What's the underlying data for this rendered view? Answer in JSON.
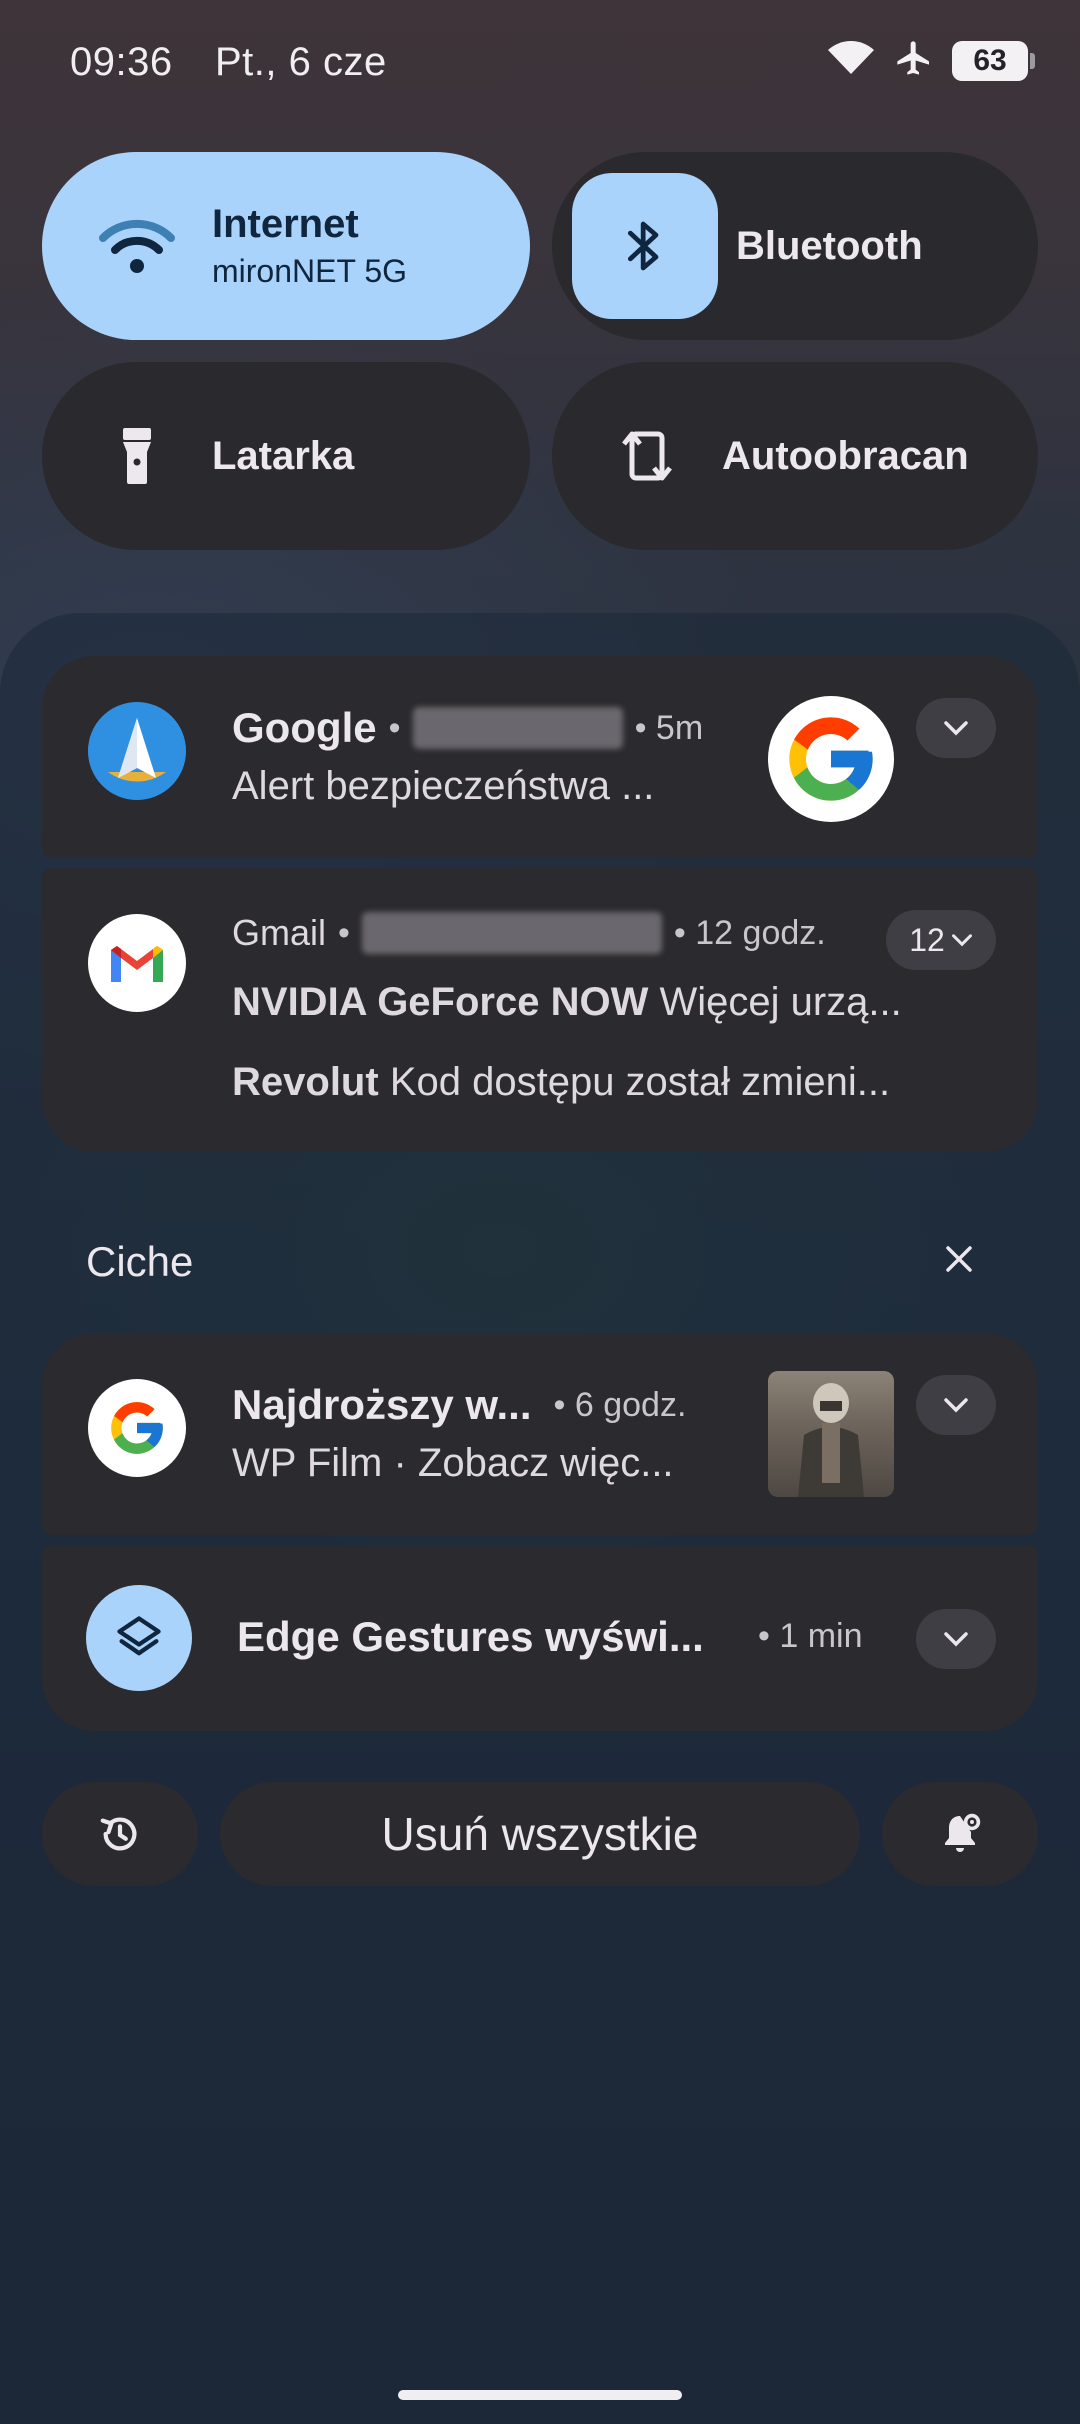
{
  "status_bar": {
    "time": "09:36",
    "date": "Pt., 6 cze",
    "battery": "63",
    "icons": [
      "wifi-icon",
      "airplane-icon",
      "battery-icon"
    ]
  },
  "quick_settings": {
    "internet": {
      "title": "Internet",
      "subtitle": "mironNET 5G",
      "active": true
    },
    "bluetooth": {
      "title": "Bluetooth",
      "active": true
    },
    "flashlight": {
      "title": "Latarka",
      "active": false
    },
    "autorotate": {
      "title": "Autoobracan",
      "active": false
    }
  },
  "notifications": {
    "google": {
      "app": "Google",
      "time": "• 5m",
      "text": "Alert bezpieczeństwa ...",
      "icon": "send-arrow-icon"
    },
    "gmail": {
      "app": "Gmail",
      "time": "• 12 godz.",
      "count": "12",
      "line1_sender": "NVIDIA GeForce NOW",
      "line1_text": "Więcej urzą...",
      "line2_sender": "Revolut",
      "line2_text": "Kod dostępu został zmieni..."
    }
  },
  "silent_section": {
    "label": "Ciche",
    "items": [
      {
        "title": "Najdroższy w...",
        "time": "• 6 godz.",
        "text": "WP Film · Zobacz więc...",
        "icon": "google-g-icon"
      },
      {
        "title": "Edge Gestures wyświ...",
        "time": "• 1 min",
        "icon": "layers-icon"
      }
    ]
  },
  "actions": {
    "history_icon": "history-icon",
    "clear_all": "Usuń wszystkie",
    "settings_icon": "notification-settings-icon"
  },
  "colors": {
    "tile_active": "#a9d3fb",
    "tile_inactive": "#2a2a2e",
    "card": "#2b2a2e"
  }
}
